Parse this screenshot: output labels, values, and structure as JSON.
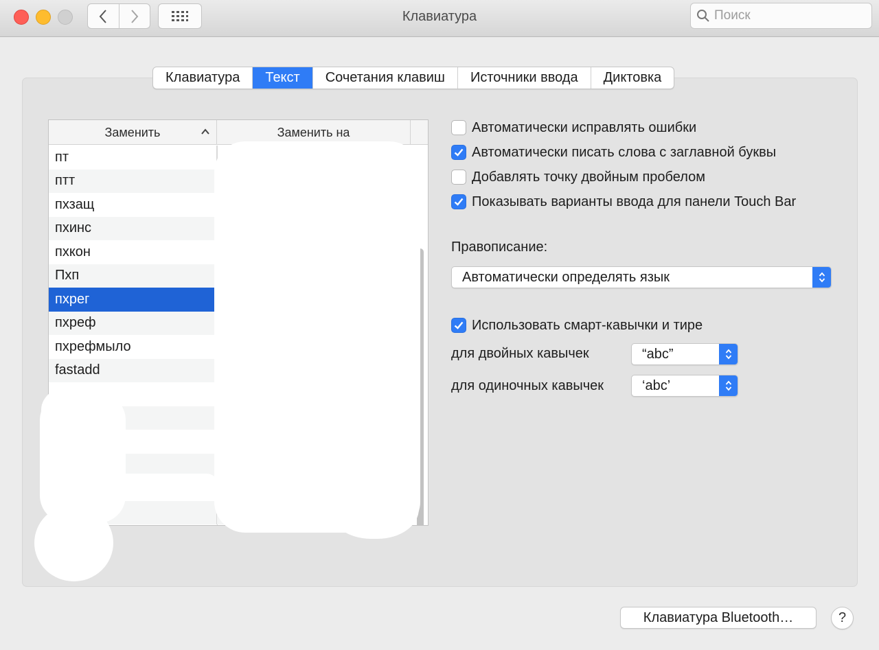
{
  "window": {
    "title": "Клавиатура"
  },
  "toolbar": {
    "search_placeholder": "Поиск"
  },
  "tabs": [
    {
      "label": "Клавиатура",
      "active": false
    },
    {
      "label": "Текст",
      "active": true
    },
    {
      "label": "Сочетания клавиш",
      "active": false
    },
    {
      "label": "Источники ввода",
      "active": false
    },
    {
      "label": "Диктовка",
      "active": false
    }
  ],
  "table": {
    "columns": [
      "Заменить",
      "Заменить на"
    ],
    "sort_icon": "chevron-up-icon",
    "rows": [
      {
        "replace": "пт",
        "with": ""
      },
      {
        "replace": "птт",
        "with": ""
      },
      {
        "replace": "пхзащ",
        "with": ""
      },
      {
        "replace": "пхинс",
        "with": ""
      },
      {
        "replace": "пхкон",
        "with": ""
      },
      {
        "replace": "Пхп",
        "with": ""
      },
      {
        "replace": "пхрег",
        "with": "",
        "selected": true
      },
      {
        "replace": "пхреф",
        "with": ""
      },
      {
        "replace": "пхрефмыло",
        "with": ""
      },
      {
        "replace": "fastadd",
        "with": ""
      }
    ]
  },
  "options": {
    "autocorrect": {
      "label": "Автоматически исправлять ошибки",
      "checked": false
    },
    "capitalize": {
      "label": "Автоматически писать слова с заглавной буквы",
      "checked": true
    },
    "double_space_period": {
      "label": "Добавлять точку двойным пробелом",
      "checked": false
    },
    "touchbar": {
      "label": "Показывать варианты ввода для панели Touch Bar",
      "checked": true
    }
  },
  "spelling": {
    "label": "Правописание:",
    "value": "Автоматически определять язык"
  },
  "smart_quotes": {
    "label": "Использовать смарт-кавычки и тире",
    "checked": true,
    "double_label": "для двойных кавычек",
    "double_value": "“abc”",
    "single_label": "для одиночных кавычек",
    "single_value": "‘abc’"
  },
  "footer": {
    "bluetooth_button": "Клавиатура Bluetooth…",
    "help": "?"
  },
  "colors": {
    "accent": "#2f7cf6",
    "selection": "#1f63d6"
  }
}
